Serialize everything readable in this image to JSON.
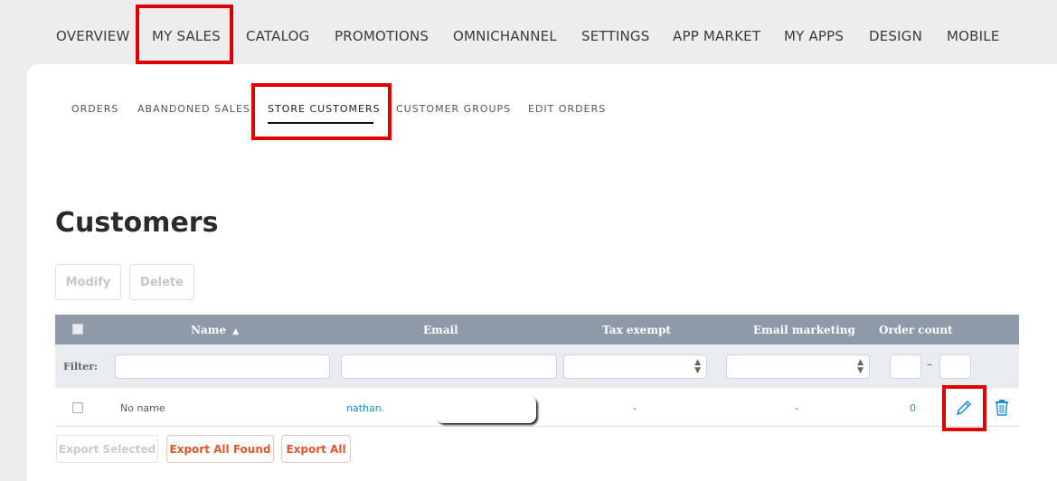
{
  "topnav": {
    "items": [
      "OVERVIEW",
      "MY SALES",
      "CATALOG",
      "PROMOTIONS",
      "OMNICHANNEL",
      "SETTINGS",
      "APP MARKET",
      "MY APPS",
      "DESIGN",
      "MOBILE"
    ]
  },
  "subnav": {
    "items": [
      "ORDERS",
      "ABANDONED SALES",
      "STORE CUSTOMERS",
      "CUSTOMER GROUPS",
      "EDIT ORDERS"
    ]
  },
  "page": {
    "title": "Customers"
  },
  "actions": {
    "modify_label": "Modify",
    "delete_label": "Delete"
  },
  "table": {
    "columns": {
      "name": "Name",
      "email": "Email",
      "tax_exempt": "Tax exempt",
      "email_marketing": "Email marketing",
      "order_count": "Order count"
    },
    "sort_indicator": "▲",
    "filter_label": "Filter:",
    "range_dash": "–",
    "rows": [
      {
        "name": "No name",
        "email": "nathan.",
        "tax_exempt": "-",
        "email_marketing": "-",
        "order_count": "0"
      }
    ]
  },
  "footer": {
    "export_selected": "Export Selected",
    "export_all_found": "Export All Found",
    "export_all": "Export All"
  },
  "colors": {
    "highlight": "#e00000",
    "accent": "#1b8fd0",
    "export": "#e8552a",
    "header": "#8e9aa8"
  },
  "icons": {
    "edit": "pencil-icon",
    "delete": "trash-icon"
  }
}
